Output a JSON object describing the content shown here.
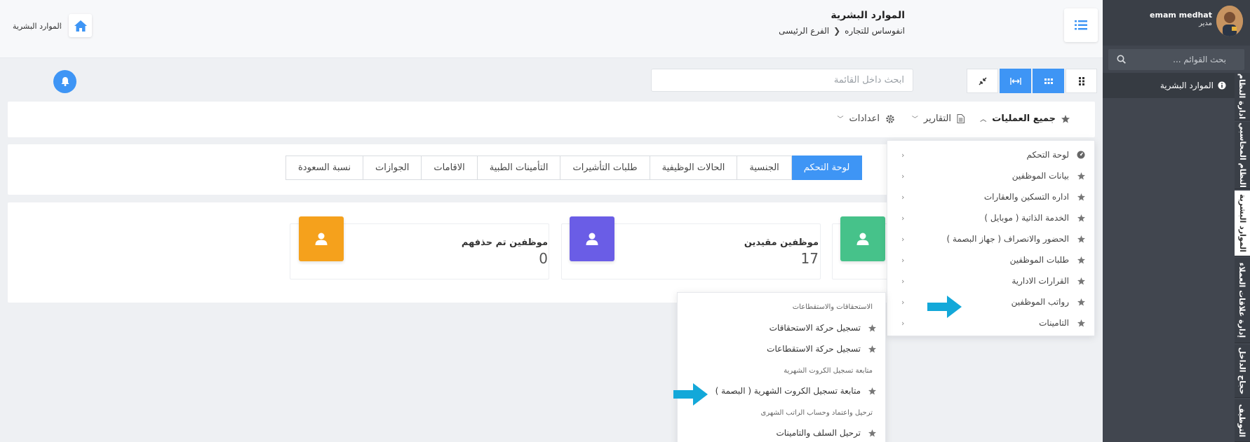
{
  "header": {
    "title": "الموارد البشرية",
    "company": "انفوساس للتجاره",
    "branch": "الفرع الرئيسى",
    "left_breadcrumb": "الموارد البشرية"
  },
  "toolbar": {
    "search_placeholder": "ابحث داخل القائمة"
  },
  "actions": {
    "all_operations": "جميع العمليات",
    "reports": "التقارير",
    "settings": "اعدادات"
  },
  "tabs": [
    "لوحة التحكم",
    "الجنسية",
    "الحالات الوظيفية",
    "طلبات التأشيرات",
    "التأمينات الطبية",
    "الاقامات",
    "الجوازات",
    "نسبة السعودة"
  ],
  "stats": [
    {
      "label": "موظفين مقيدين",
      "value": "17",
      "color": "#46c28a"
    },
    {
      "label": "موظفين تم حذفهم",
      "value": "0",
      "color": "#f5a11c"
    }
  ],
  "stats_colors": {
    "purple": "#6a5de6",
    "green": "#46c28a"
  },
  "dropdown": [
    {
      "label": "لوحة التحكم",
      "icon": "dashboard-icon"
    },
    {
      "label": "بيانات الموظفين",
      "icon": "star-icon"
    },
    {
      "label": "اداره التسكين والعقارات",
      "icon": "star-icon"
    },
    {
      "label": "الخدمة الذاتية ( موبايل )",
      "icon": "star-icon"
    },
    {
      "label": "الحضور والانصراف ( جهاز البصمة )",
      "icon": "star-icon"
    },
    {
      "label": "طلبات الموظفين",
      "icon": "star-icon"
    },
    {
      "label": "القرارات الادارية",
      "icon": "star-icon"
    },
    {
      "label": "رواتب الموظفين",
      "icon": "star-icon"
    },
    {
      "label": "التامينات",
      "icon": "star-icon"
    }
  ],
  "submenu": {
    "heading1": "الاستحقاقات والاستقطاعات",
    "item1": "تسجيل حركة الاستحقاقات",
    "item2": "تسجيل حركة الاستقطاعات",
    "heading2": "متابعة تسجيل الكروت الشهرية",
    "item3": "متابعة تسجيل الكروت الشهرية ( البصمة )",
    "heading3": "ترحيل واعتماد وحساب الراتب الشهرى",
    "item4": "ترحيل السلف والتامينات"
  },
  "sidebar": {
    "user_name": "emam medhat",
    "user_role": "مدير",
    "search_placeholder": "بحث القوائم ...",
    "active_item": "الموارد البشرية",
    "tabs": [
      "ادارة النظام",
      "النظام المحاسبي",
      "الموارد البشرية",
      "إدارة علاقات العملاء",
      "حجاج الداخل",
      "التوظيف"
    ]
  },
  "colors": {
    "accent": "#3e95f5",
    "arrow": "#13a8d9",
    "sidebar_bg": "#41464f"
  }
}
